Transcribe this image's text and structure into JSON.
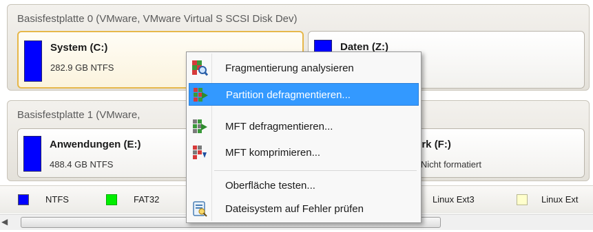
{
  "disk0": {
    "title": "Basisfestplatte 0 (VMware, VMware Virtual S SCSI Disk Dev)",
    "partitions": [
      {
        "name": "System (C:)",
        "info": "282.9 GB NTFS",
        "color": "#0000ff"
      },
      {
        "name": "Daten (Z:)",
        "info": "",
        "color": "#0000ff"
      }
    ]
  },
  "disk1": {
    "title": "Basisfestplatte 1 (VMware,",
    "partitions": [
      {
        "name": "Anwendungen (E:)",
        "info": "488.4 GB NTFS",
        "color": "#0000ff"
      },
      {
        "name": "erk (F:)",
        "info": "3 Nicht formatiert",
        "color": "#0000ff"
      }
    ]
  },
  "context_menu": {
    "items": [
      {
        "label": "Fragmentierung analysieren",
        "icon": "analyze-fragmentation-icon"
      },
      {
        "label": "Partition defragmentieren...",
        "icon": "defragment-partition-icon",
        "highlighted": true
      },
      {
        "label": "MFT defragmentieren...",
        "icon": "defragment-mft-icon"
      },
      {
        "label": "MFT komprimieren...",
        "icon": "compact-mft-icon"
      },
      {
        "label": "Oberfläche testen...",
        "icon": ""
      },
      {
        "label": "Dateisystem auf Fehler prüfen",
        "icon": "check-filesystem-icon"
      }
    ]
  },
  "legend": [
    {
      "label": "NTFS",
      "color": "#0000ff"
    },
    {
      "label": "FAT32",
      "color": "#00ee00"
    },
    {
      "label": "Linux Ext3",
      "color": ""
    },
    {
      "label": "Linux Ext",
      "color": "#ffffcc"
    }
  ]
}
